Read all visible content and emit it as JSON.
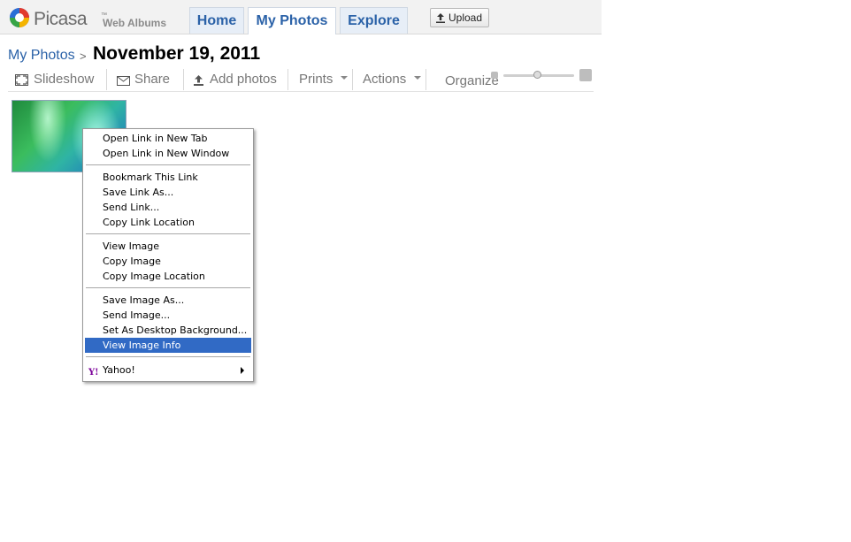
{
  "header": {
    "logo_text": "Picasa",
    "logo_tm": "™",
    "logo_sub": "Web Albums",
    "tabs": [
      {
        "label": "Home"
      },
      {
        "label": "My Photos"
      },
      {
        "label": "Explore"
      }
    ],
    "upload_label": "Upload"
  },
  "breadcrumb": {
    "parent": "My Photos",
    "separator": ">",
    "title": "November 19, 2011"
  },
  "toolbar": {
    "slideshow": "Slideshow",
    "share": "Share",
    "add_photos": "Add photos",
    "prints": "Prints",
    "actions": "Actions",
    "organize": "Organize"
  },
  "context_menu": {
    "items": [
      {
        "label": "Open Link in New Tab"
      },
      {
        "label": "Open Link in New Window"
      },
      {
        "label": "Bookmark This Link"
      },
      {
        "label": "Save Link As..."
      },
      {
        "label": "Send Link..."
      },
      {
        "label": "Copy Link Location"
      },
      {
        "label": "View Image"
      },
      {
        "label": "Copy Image"
      },
      {
        "label": "Copy Image Location"
      },
      {
        "label": "Save Image As..."
      },
      {
        "label": "Send Image..."
      },
      {
        "label": "Set As Desktop Background..."
      },
      {
        "label": "View Image Info",
        "selected": true
      },
      {
        "label": "Yahoo!",
        "icon": "yahoo-icon",
        "submenu": true
      }
    ]
  },
  "colors": {
    "link_blue": "#2b62a8",
    "menu_highlight": "#316ac5",
    "tab_bg": "#e7eef7"
  }
}
